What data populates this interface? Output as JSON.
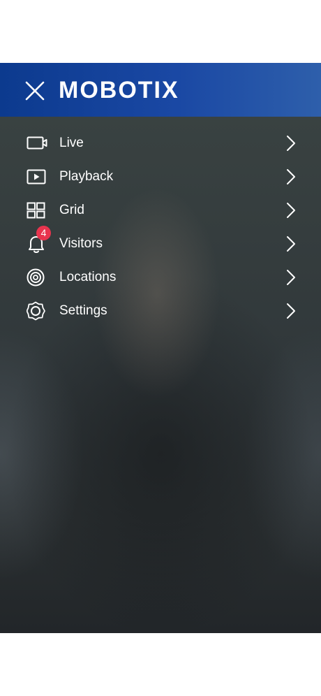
{
  "header": {
    "brand": "MOBOTIX",
    "close_icon": "close-icon",
    "background_color": "#0c3a8e"
  },
  "menu": {
    "items": [
      {
        "label": "Live",
        "icon": "camera-icon"
      },
      {
        "label": "Playback",
        "icon": "playback-icon"
      },
      {
        "label": "Grid",
        "icon": "grid-icon"
      },
      {
        "label": "Visitors",
        "icon": "bell-icon",
        "badge": "4"
      },
      {
        "label": "Locations",
        "icon": "locations-icon"
      },
      {
        "label": "Settings",
        "icon": "settings-icon"
      }
    ],
    "chevron_icon": "chevron-right-icon",
    "badge_color": "#e8344e"
  }
}
